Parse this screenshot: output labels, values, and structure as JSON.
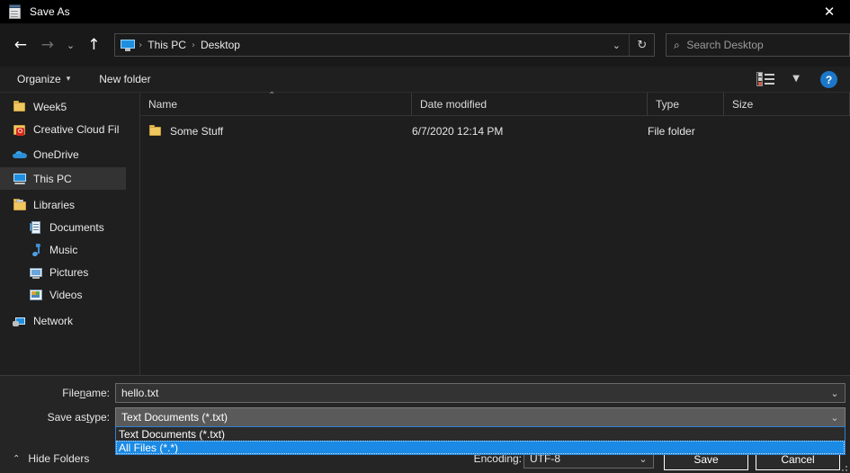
{
  "window": {
    "title": "Save As",
    "title_icon": "notepad-icon",
    "close_label": "✕"
  },
  "navbar": {
    "back_icon": "arrow-left-icon",
    "forward_icon": "arrow-right-icon",
    "recent_icon": "chevron-down-icon",
    "up_icon": "arrow-up-icon",
    "address": {
      "icon": "this-pc-icon",
      "crumbs": [
        "This PC",
        "Desktop"
      ],
      "separator": "›",
      "dropdown_icon": "chevron-down-icon",
      "refresh_icon": "refresh-icon",
      "refresh_glyph": "↻"
    },
    "search": {
      "placeholder": "Search Desktop",
      "value": "",
      "icon": "search-icon",
      "glyph": "⌕"
    }
  },
  "commandbar": {
    "organize_label": "Organize",
    "organize_caret": "▾",
    "new_folder_label": "New folder",
    "view_icon": "view-layout-icon",
    "view_caret": "▼",
    "help_label": "?"
  },
  "sidebar": {
    "items": [
      {
        "label": "Week5",
        "icon": "folder-icon",
        "indent": false,
        "selected": false
      },
      {
        "label": "Creative Cloud Fil",
        "icon": "creative-cloud-icon",
        "indent": false,
        "selected": false
      },
      {
        "label": "OneDrive",
        "icon": "onedrive-cloud-icon",
        "indent": false,
        "selected": false
      },
      {
        "label": "This PC",
        "icon": "this-pc-icon",
        "indent": false,
        "selected": true
      },
      {
        "label": "Libraries",
        "icon": "libraries-folder-icon",
        "indent": false,
        "selected": false
      },
      {
        "label": "Documents",
        "icon": "documents-icon",
        "indent": true,
        "selected": false
      },
      {
        "label": "Music",
        "icon": "music-icon",
        "indent": true,
        "selected": false
      },
      {
        "label": "Pictures",
        "icon": "pictures-icon",
        "indent": true,
        "selected": false
      },
      {
        "label": "Videos",
        "icon": "videos-icon",
        "indent": true,
        "selected": false
      },
      {
        "label": "Network",
        "icon": "network-icon",
        "indent": false,
        "selected": false
      }
    ],
    "scroll_up_glyph": "⌃",
    "scroll_down_glyph": "⌄"
  },
  "filelist": {
    "columns": [
      {
        "label": "Name",
        "sorted": "ascending",
        "sort_glyph": "⌃"
      },
      {
        "label": "Date modified",
        "sorted": "",
        "sort_glyph": ""
      },
      {
        "label": "Type",
        "sorted": "",
        "sort_glyph": ""
      },
      {
        "label": "Size",
        "sorted": "",
        "sort_glyph": ""
      }
    ],
    "rows": [
      {
        "name": "Some Stuff",
        "date_modified": "6/7/2020 12:14 PM",
        "type": "File folder",
        "size": "",
        "icon": "folder-icon"
      }
    ]
  },
  "form": {
    "filename_label_pre": "File ",
    "filename_label_mnemonic": "n",
    "filename_label_post": "ame:",
    "filename_value": "hello.txt",
    "filename_caret": "⌄",
    "savetype_label_pre": "Save as ",
    "savetype_label_mnemonic": "t",
    "savetype_label_post": "ype:",
    "savetype_value": "Text Documents (*.txt)",
    "savetype_caret": "⌄",
    "savetype_options": [
      {
        "label": "Text Documents (*.txt)",
        "selected": false
      },
      {
        "label": "All Files  (*.*)",
        "selected": true
      }
    ],
    "hide_folders_label": "Hide Folders",
    "hide_folders_caret": "⌃",
    "encoding_label": "Encoding:",
    "encoding_value": "UTF-8",
    "encoding_caret": "⌄",
    "save_button": "Save",
    "cancel_button": "Cancel"
  },
  "colors": {
    "accent_highlight": "#1a8ae5",
    "window_bg": "#1f1f1f",
    "bottom_pane_bg": "#252525",
    "folder_yellow": "#f0c75e",
    "help_blue": "#1c77c9"
  }
}
